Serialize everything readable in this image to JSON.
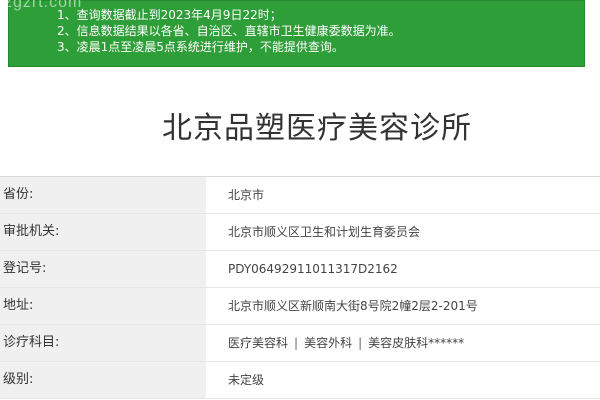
{
  "watermark": "zgzrt.com",
  "notice": {
    "lines": [
      "1、查询数据截止到2023年4月9日22时；",
      "2、信息数据结果以各省、自治区、直辖市卫生健康委数据为准。",
      "3、凌晨1点至凌晨5点系统进行维护，不能提供查询。"
    ],
    "background": "#2e9e38"
  },
  "title": "北京品塑医疗美容诊所",
  "rows": [
    {
      "label": "省份:",
      "value": "北京市"
    },
    {
      "label": "审批机关:",
      "value": "北京市顺义区卫生和计划生育委员会"
    },
    {
      "label": "登记号:",
      "value": "PDY06492911011317D2162"
    },
    {
      "label": "地址:",
      "value": "北京市顺义区新顺南大街8号院2幢2层2-201号"
    },
    {
      "label": "诊疗科目:",
      "subjects": [
        "医疗美容科",
        "美容外科",
        "美容皮肤科******"
      ],
      "separator": "|"
    },
    {
      "label": "级别:",
      "value": "未定级"
    }
  ]
}
